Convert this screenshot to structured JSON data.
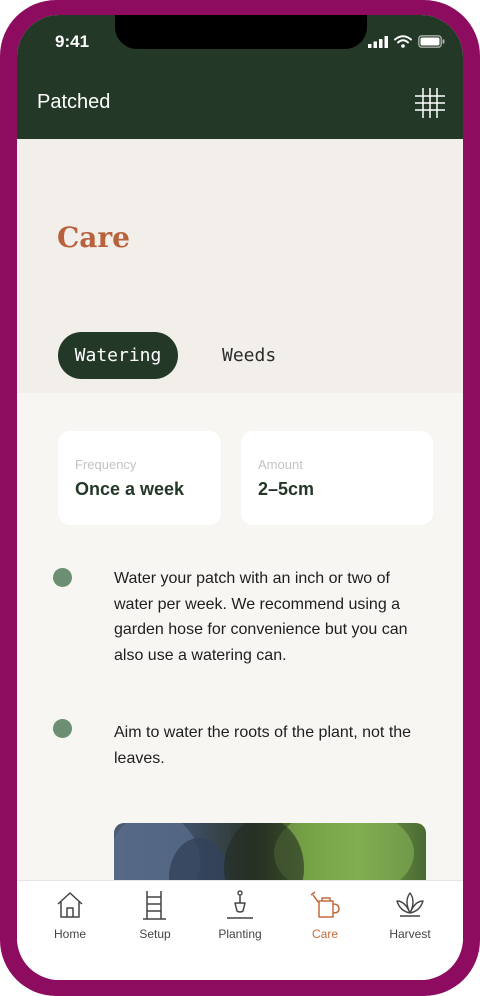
{
  "status_bar": {
    "time": "9:41"
  },
  "app_bar": {
    "title": "Patched",
    "grid_icon": "grid-icon"
  },
  "page": {
    "title": "Care"
  },
  "tabs": [
    {
      "label": "Watering",
      "active": true
    },
    {
      "label": "Weeds",
      "active": false
    }
  ],
  "cards": [
    {
      "label": "Frequency",
      "value": "Once a week"
    },
    {
      "label": "Amount",
      "value": "2–5cm"
    }
  ],
  "tips": [
    "Water your patch with an inch or two of water per week. We recommend using a garden hose for convenience but you can also use a watering can.",
    "Aim to water the roots of the plant, not the leaves."
  ],
  "nav": [
    {
      "label": "Home",
      "icon": "home-icon",
      "active": false
    },
    {
      "label": "Setup",
      "icon": "ladder-icon",
      "active": false
    },
    {
      "label": "Planting",
      "icon": "trowel-icon",
      "active": false
    },
    {
      "label": "Care",
      "icon": "watering-can-icon",
      "active": true
    },
    {
      "label": "Harvest",
      "icon": "lotus-icon",
      "active": false
    }
  ],
  "colors": {
    "frame": "#8e0c60",
    "header": "#243828",
    "accent": "#b8613d",
    "bullet": "#6b8f70",
    "nav_active": "#c46b3e"
  }
}
